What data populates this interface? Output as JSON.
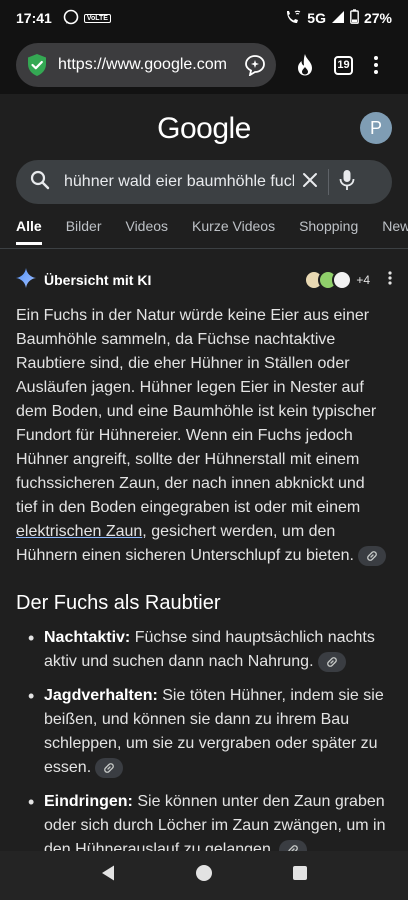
{
  "status": {
    "time": "17:41",
    "volte": "VoLTE",
    "network": "5G",
    "battery": "27%"
  },
  "browser": {
    "url": "https://www.google.com",
    "tab_count": "19"
  },
  "google": {
    "logo": "Google",
    "avatar_letter": "P",
    "query": "hühner wald eier baumhöhle fuchs"
  },
  "tabs": [
    "Alle",
    "Bilder",
    "Videos",
    "Kurze Videos",
    "Shopping",
    "News"
  ],
  "ai": {
    "title": "Übersicht mit KI",
    "sources_more": "+4",
    "p1_a": "Ein Fuchs in der Natur würde keine Eier aus einer Baumhöhle sammeln, da Füchse nachtaktive Raubtiere sind, die eher Hühner in Ställen oder Ausläufen jagen. Hühner legen Eier in Nester auf dem Boden, und eine Baumhöhle ist kein typischer Fundort für Hühnereier. Wenn ein Fuchs jedoch Hühner angreift, sollte der Hühnerstall mit einem fuchssicheren Zaun, der nach innen abknickt und tief in den Boden eingegraben ist oder mit einem ",
    "p1_link": "elektrischen Zaun",
    "p1_b": ", gesichert werden, um den Hühnern einen sicheren Unterschlupf zu bieten.",
    "heading": "Der Fuchs als Raubtier",
    "bullets": [
      {
        "term": "Nachtaktiv:",
        "text": " Füchse sind hauptsächlich nachts aktiv und suchen dann nach Nahrung."
      },
      {
        "term": "Jagdverhalten:",
        "text": " Sie töten Hühner, indem sie sie beißen, und können sie dann zu ihrem Bau schleppen, um sie zu vergraben oder später zu essen."
      },
      {
        "term": "Eindringen:",
        "text": " Sie können unter den Zaun graben oder sich durch Löcher im Zaun zwängen, um in den Hühnerauslauf zu gelangen."
      }
    ]
  },
  "colors": {
    "background": "#1f1f1f",
    "searchbox": "#3c4043",
    "secure_shield": "#34a853"
  }
}
